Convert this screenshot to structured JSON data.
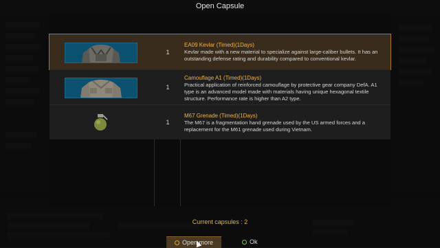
{
  "modal": {
    "title": "Open Capsule",
    "items": [
      {
        "name": "EA09 Kevlar (Timed)(1Days)",
        "qty": "1",
        "desc": "Kevlar made with a new material to specialize against large-caliber bullets. It has an outstanding defense rating and durability compared to conventional kevlar.",
        "icon": "kevlar-vest-icon"
      },
      {
        "name": "Camouflage A1 (Timed)(1Days)",
        "qty": "1",
        "desc": "Practical application of reinforced camouflage by protective gear company DefA. A1 type is an advanced model made with materials having unique hexagonal textile structure. Performance rate is higher than A2 type.",
        "icon": "camouflage-vest-icon"
      },
      {
        "name": "M67 Grenade (Timed)(1Days)",
        "qty": "1",
        "desc": "The M67 is a fragmentation hand grenade used by the US armed forces and a replacement for the M61 grenade used during Vietnam.",
        "icon": "grenade-icon"
      }
    ],
    "capsules_label": "Current capsules : 2",
    "open_more_label": "Open more",
    "ok_label": "Ok"
  },
  "colors": {
    "accent": "#f0b34a",
    "selected_outline": "#a8762c",
    "thumb_bg": "#0d5170",
    "ok_ring": "#7bc251"
  }
}
